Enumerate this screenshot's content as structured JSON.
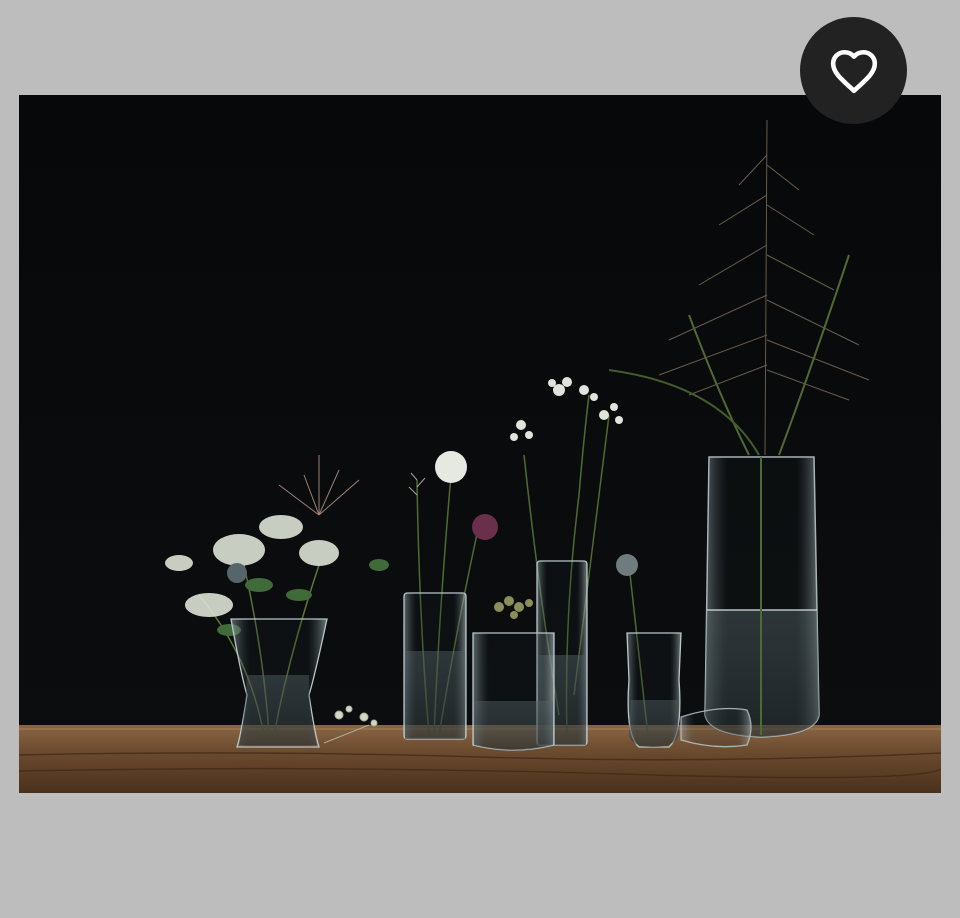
{
  "product_image": {
    "icon": "vase-product-photo",
    "colors": {
      "backdrop": "#050607",
      "table": "#6b4a2e",
      "glass": "#c9d3d6"
    }
  },
  "favorite_button": {
    "icon": "heart-icon",
    "color": "#222222",
    "selected": false
  },
  "page": {
    "background": "#bdbdbd"
  }
}
